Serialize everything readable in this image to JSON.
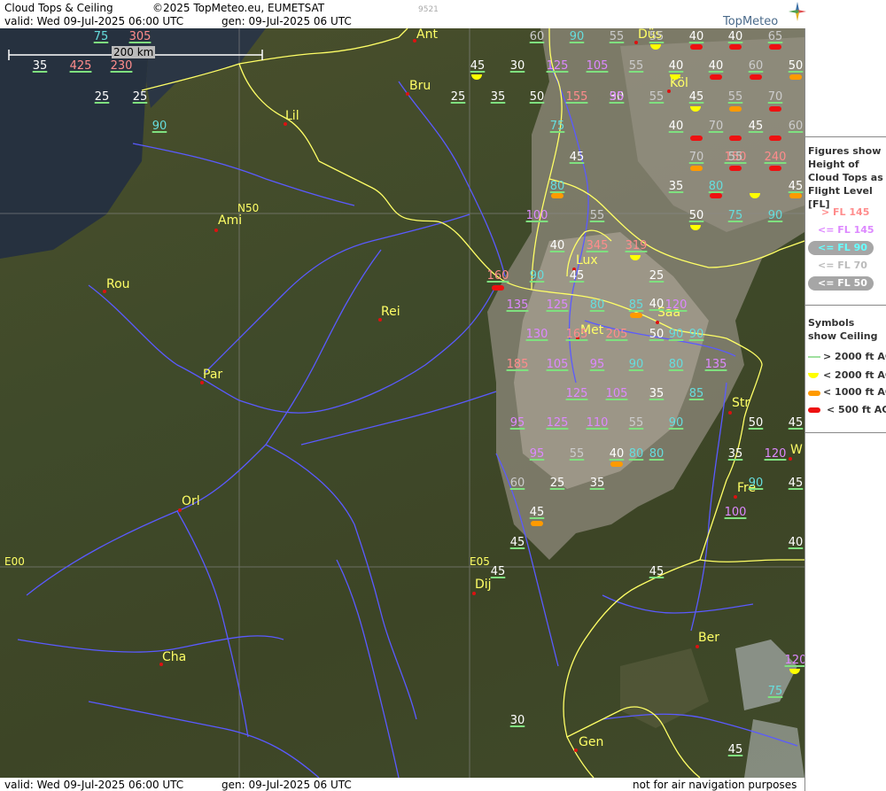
{
  "header": {
    "title": "Cloud Tops & Ceiling",
    "copyright": "©2025 TopMeteo.eu, EUMETSAT",
    "code": "9521",
    "valid": "valid:  Wed  09-Jul-2025  06:00 UTC",
    "gen": "gen: 09-Jul-2025 06 UTC",
    "brand": "TopMeteo"
  },
  "footer": {
    "valid": "valid:  Wed  09-Jul-2025  06:00 UTC",
    "gen": "gen: 09-Jul-2025 06 UTC",
    "note": "not for air navigation purposes"
  },
  "scale": {
    "label": "200 km"
  },
  "grid_labels": [
    "N50",
    "E00",
    "E05"
  ],
  "colors": {
    "above145": "#ff8c8c",
    "le145": "#dd88ff",
    "le90": "#66dddd",
    "le70": "#cccccc",
    "le50": "#ffffff",
    "city": "#ffff66",
    "border": "#ffff66",
    "river": "#5a5aff"
  },
  "legend": {
    "figures_title": "Figures show Height of Cloud Tops as Flight Level  [FL]",
    "fl_items": [
      "> FL 145",
      "<= FL 145",
      "<= FL 90",
      "<= FL 70",
      "<= FL 50"
    ],
    "symbols_title": "Symbols show Ceiling",
    "ceiling_items": [
      "> 2000 ft AGL",
      "< 2000 ft AGL",
      "< 1000 ft AGL",
      "< 500 ft AGL"
    ]
  },
  "cities": [
    "Ant",
    "Bru",
    "Lil",
    "Ami",
    "Rou",
    "Rei",
    "Par",
    "Orl",
    "Cha",
    "Dij",
    "Lux",
    "Met",
    "Saa",
    "Str",
    "Fre",
    "Ber",
    "Gen",
    "Köl",
    "Düs",
    "W"
  ],
  "figures": [
    "75",
    "305",
    "35",
    "425",
    "230",
    "25",
    "25",
    "90",
    "60",
    "90",
    "55",
    "55",
    "40",
    "40",
    "65",
    "45",
    "30",
    "125",
    "105",
    "55",
    "40",
    "40",
    "60",
    "50",
    "25",
    "35",
    "50",
    "155",
    "30",
    "55",
    "45",
    "55",
    "70",
    "75",
    "70",
    "45",
    "60",
    "70",
    "150",
    "240",
    "100",
    "80",
    "40",
    "345",
    "319",
    "45",
    "90",
    "160",
    "135",
    "125",
    "80",
    "85",
    "120",
    "130",
    "165",
    "205",
    "50",
    "90",
    "185",
    "105",
    "95",
    "90",
    "80",
    "135",
    "125",
    "105",
    "35",
    "85",
    "95",
    "125",
    "110",
    "55",
    "90",
    "95",
    "55",
    "40",
    "80",
    "60",
    "25",
    "35",
    "45",
    "45",
    "45",
    "45",
    "50",
    "45",
    "35",
    "120",
    "45",
    "90",
    "100",
    "40",
    "120",
    "75",
    "30",
    "45",
    "40",
    "95",
    "50",
    "35",
    "45",
    "80",
    "75",
    "90",
    "45",
    "55",
    "40",
    "90",
    "55",
    "25",
    "80"
  ],
  "values_hidden": []
}
